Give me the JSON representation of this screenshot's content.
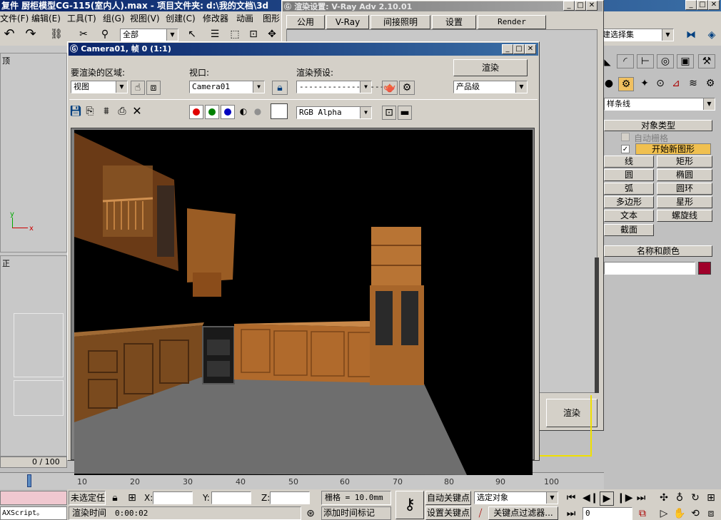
{
  "main": {
    "title": "复件 厨柜模型CG-115(室内人).max   - 项目文件夹: d:\\我的文档\\3d",
    "menu": [
      "文件(F)",
      "编辑(E)",
      "工具(T)",
      "组(G)",
      "视图(V)",
      "创建(C)",
      "修改器",
      "动画",
      "图形"
    ],
    "selection_filter": "全部",
    "named_selection": "建选择集",
    "viewport_label_top": "顶",
    "viewport_label_front": "正",
    "frame_counter": "0 / 100",
    "ruler_ticks": [
      "10",
      "20",
      "30",
      "40",
      "50",
      "60",
      "70",
      "80",
      "90",
      "100"
    ]
  },
  "render_setup": {
    "title": "渲染设置: V-Ray Adv 2.10.01",
    "tabs": [
      "公用",
      "V-Ray",
      "间接照明",
      "设置",
      "Render Elements"
    ],
    "render_button": "渲染"
  },
  "frame_window": {
    "title": "Camera01, 帧 0 (1:1)",
    "area_label": "要渲染的区域:",
    "area_value": "视图",
    "viewport_label": "视口:",
    "viewport_value": "Camera01",
    "preset_label": "渲染预设:",
    "preset_value": "--------------------",
    "render_button": "渲染",
    "quality_value": "产品级",
    "channel_value": "RGB Alpha",
    "colors": {
      "red": "#e00000",
      "green": "#008000",
      "blue": "#0000c0",
      "swatch": "#ffffff"
    }
  },
  "command_panel": {
    "category": "样条线",
    "rollout_object_type": "对象类型",
    "auto_grid": "自动栅格",
    "start_new_shape": "开始新图形",
    "buttons": [
      "线",
      "矩形",
      "圆",
      "椭圆",
      "弧",
      "圆环",
      "多边形",
      "星形",
      "文本",
      "螺旋线",
      "截面"
    ],
    "rollout_name_color": "名称和颜色",
    "object_color": "#a0002a"
  },
  "status": {
    "script_label": "AXScript。",
    "selection_status": "未选定任",
    "x_label": "X:",
    "y_label": "Y:",
    "z_label": "Z:",
    "grid": "栅格 = 10.0mm",
    "render_time_label": "渲染时间",
    "render_time": "0:00:02",
    "add_time_tag": "添加时间标记",
    "auto_key": "自动关键点",
    "set_key": "设置关键点",
    "selected_object": "选定对象",
    "key_filters": "关键点过滤器...",
    "frame_value": "0"
  }
}
